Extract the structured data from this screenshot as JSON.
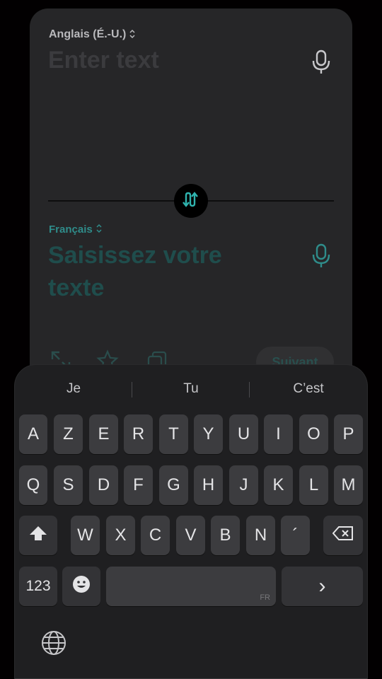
{
  "card": {
    "source_lang": "Anglais (É.-U.)",
    "source_placeholder": "Enter text",
    "target_lang": "Français",
    "target_placeholder": "Saisissez votre texte",
    "next_label": "Suivant",
    "accent_color": "#2f8c8a"
  },
  "keyboard": {
    "suggestions": [
      "Je",
      "Tu",
      "C’est"
    ],
    "row1": [
      "A",
      "Z",
      "E",
      "R",
      "T",
      "Y",
      "U",
      "I",
      "O",
      "P"
    ],
    "row2": [
      "Q",
      "S",
      "D",
      "F",
      "G",
      "H",
      "J",
      "K",
      "L",
      "M"
    ],
    "row3": [
      "W",
      "X",
      "C",
      "V",
      "B",
      "N",
      "´"
    ],
    "numbers_label": "123",
    "space_lang": "FR",
    "next_symbol": "›"
  },
  "icons": [
    "chevron-updown-icon",
    "microphone-icon",
    "swap-icon",
    "expand-icon",
    "star-icon",
    "copy-icon",
    "shift-icon",
    "backspace-icon",
    "emoji-icon",
    "globe-icon"
  ]
}
